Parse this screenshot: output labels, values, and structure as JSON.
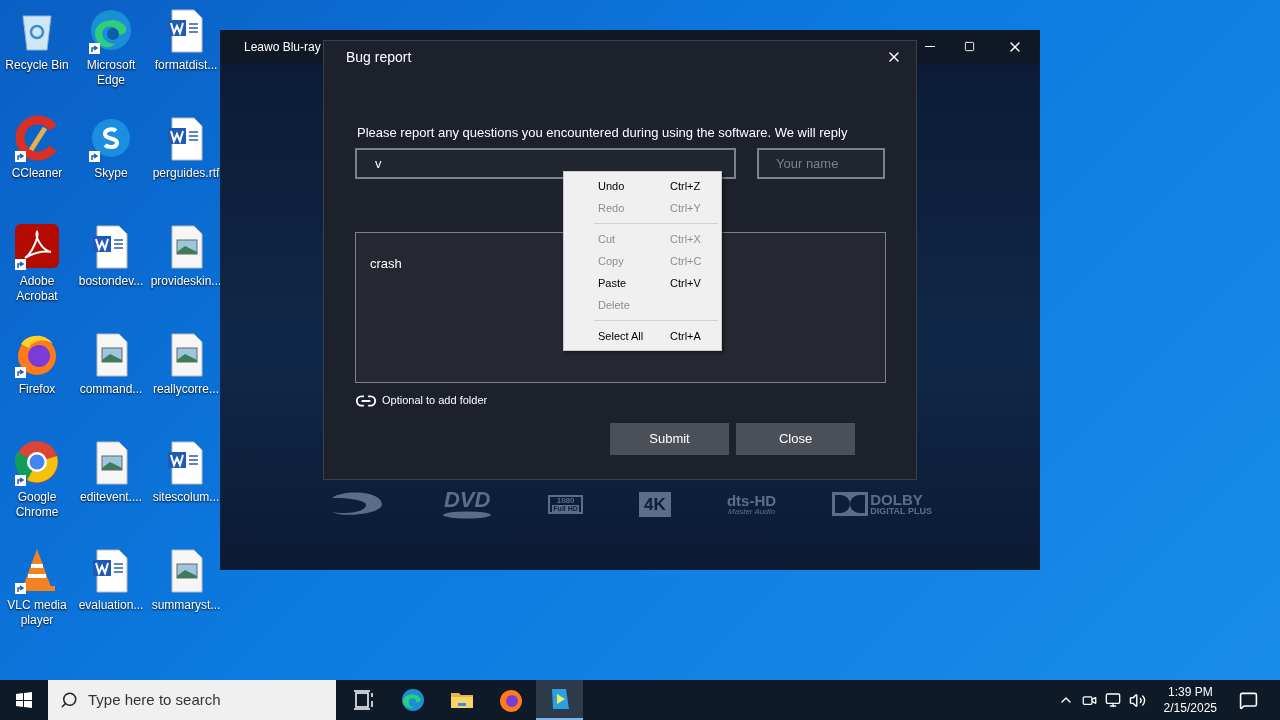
{
  "desktop_icons": [
    {
      "label": "Recycle Bin",
      "kind": "recycle",
      "shortcut": false
    },
    {
      "label": "Microsoft Edge",
      "kind": "edge",
      "shortcut": true
    },
    {
      "label": "formatdist...",
      "kind": "word",
      "shortcut": false
    },
    {
      "label": "CCleaner",
      "kind": "ccleaner",
      "shortcut": true
    },
    {
      "label": "Skype",
      "kind": "skype",
      "shortcut": true
    },
    {
      "label": "perguides.rtf",
      "kind": "word",
      "shortcut": false
    },
    {
      "label": "Adobe Acrobat",
      "kind": "acrobat",
      "shortcut": true
    },
    {
      "label": "bostondev...",
      "kind": "word",
      "shortcut": false
    },
    {
      "label": "provideskin...",
      "kind": "image",
      "shortcut": false
    },
    {
      "label": "Firefox",
      "kind": "firefox",
      "shortcut": true
    },
    {
      "label": "command...",
      "kind": "image",
      "shortcut": false
    },
    {
      "label": "reallycorre...",
      "kind": "image",
      "shortcut": false
    },
    {
      "label": "Google Chrome",
      "kind": "chrome",
      "shortcut": true
    },
    {
      "label": "editevent....",
      "kind": "image",
      "shortcut": false
    },
    {
      "label": "sitescolum...",
      "kind": "word",
      "shortcut": false
    },
    {
      "label": "VLC media player",
      "kind": "vlc",
      "shortcut": true
    },
    {
      "label": "evaluation...",
      "kind": "word",
      "shortcut": false
    },
    {
      "label": "summaryst...",
      "kind": "image",
      "shortcut": false
    }
  ],
  "app_window": {
    "title": "Leawo Blu-ray",
    "formats": [
      "DVD",
      "1080",
      "Full HD",
      "4K",
      "dts-HD",
      "Master Audio",
      "DOLBY",
      "DIGITAL PLUS"
    ]
  },
  "dialog": {
    "title": "Bug report",
    "prompt": "Please report any questions you encountered during using the software. We will reply",
    "email_field": {
      "value": "v"
    },
    "name_field": {
      "placeholder": "Your name"
    },
    "description": {
      "value": "crash"
    },
    "attach_link": "Optional to add folder",
    "buttons": [
      "Submit",
      "Close"
    ]
  },
  "context_menu": [
    {
      "kind": "item",
      "label": "Undo",
      "shortcut": "Ctrl+Z",
      "disabled": false
    },
    {
      "kind": "item",
      "label": "Redo",
      "shortcut": "Ctrl+Y",
      "disabled": true
    },
    {
      "kind": "separator"
    },
    {
      "kind": "item",
      "label": "Cut",
      "shortcut": "Ctrl+X",
      "disabled": true
    },
    {
      "kind": "item",
      "label": "Copy",
      "shortcut": "Ctrl+C",
      "disabled": true
    },
    {
      "kind": "item",
      "label": "Paste",
      "shortcut": "Ctrl+V",
      "disabled": false
    },
    {
      "kind": "item",
      "label": "Delete",
      "disabled": true
    },
    {
      "kind": "separator"
    },
    {
      "kind": "item",
      "label": "Select All",
      "shortcut": "Ctrl+A",
      "disabled": false
    }
  ],
  "taskbar": {
    "search_placeholder": "Type here to search",
    "apps": [
      {
        "kind": "taskview",
        "selected": false
      },
      {
        "kind": "edge",
        "selected": false
      },
      {
        "kind": "explorer",
        "selected": false
      },
      {
        "kind": "firefox",
        "selected": false
      },
      {
        "kind": "leawo",
        "selected": true
      }
    ],
    "time": "1:39 PM",
    "date": "2/15/2025"
  }
}
